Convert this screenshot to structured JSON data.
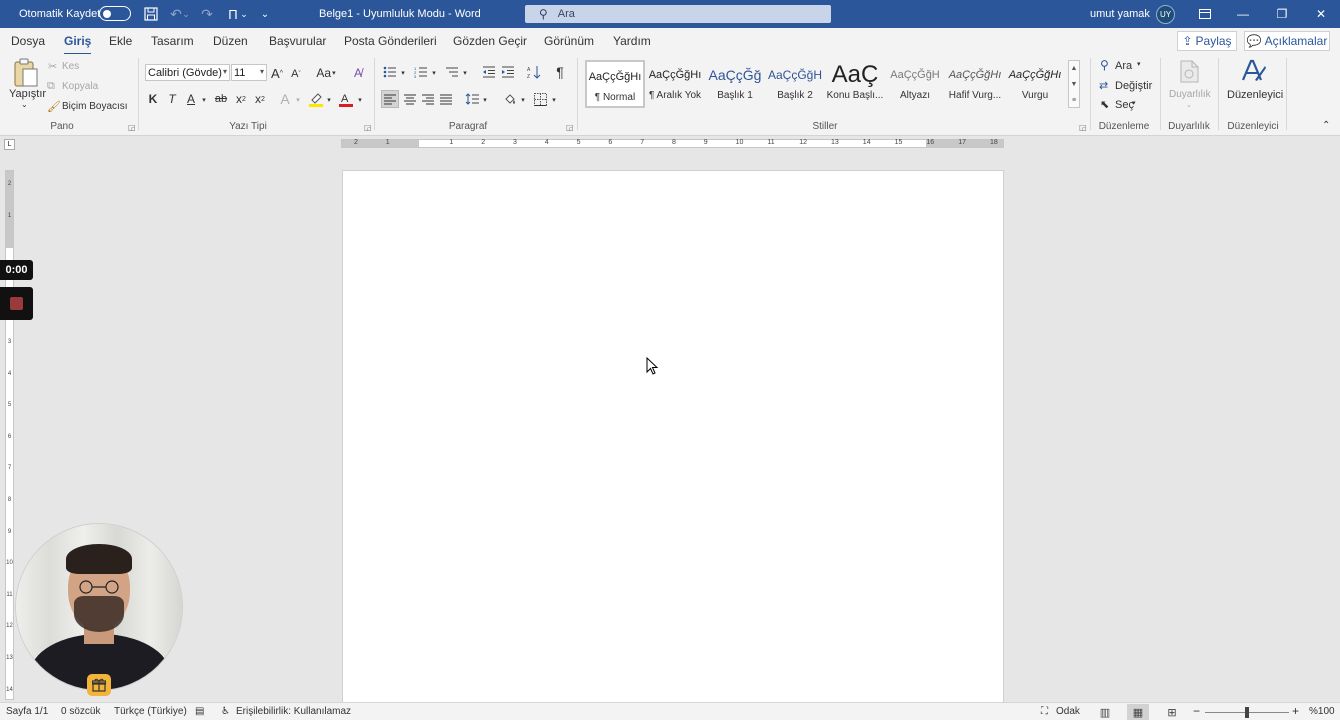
{
  "titlebar": {
    "autosave_label": "Otomatik Kaydet",
    "save_icon": "save-icon",
    "undo_icon": "undo-icon",
    "redo_icon": "redo-icon",
    "customize_icon": "customize-qat-icon",
    "doc_title": "Belge1  -  Uyumluluk Modu  -  Word",
    "search_placeholder": "Ara",
    "user_name": "umut yamak",
    "user_initials": "UY",
    "ribbon_display_icon": "ribbon-display-icon",
    "minimize_glyph": "—",
    "restore_glyph": "❐",
    "close_glyph": "✕"
  },
  "menu": {
    "tabs": [
      "Dosya",
      "Giriş",
      "Ekle",
      "Tasarım",
      "Düzen",
      "Başvurular",
      "Posta Gönderileri",
      "Gözden Geçir",
      "Görünüm",
      "Yardım"
    ],
    "active_tab": "Giriş",
    "share_label": "Paylaş",
    "comments_label": "Açıklamalar"
  },
  "ribbon": {
    "clipboard": {
      "paste": "Yapıştır",
      "cut": "Kes",
      "copy": "Kopyala",
      "format_painter": "Biçim Boyacısı",
      "label": "Pano"
    },
    "font": {
      "font_name": "Calibri (Gövde)",
      "font_size": "11",
      "grow": "A",
      "shrink": "A",
      "case": "Aa",
      "bold": "K",
      "italic": "T",
      "underline": "A",
      "strike": "ab",
      "subscript": "x",
      "superscript": "x",
      "label": "Yazı Tipi"
    },
    "paragraph": {
      "show_marks": "¶",
      "label": "Paragraf"
    },
    "styles": {
      "items": [
        {
          "preview": "AaÇçĞğHı",
          "name": "¶ Normal"
        },
        {
          "preview": "AaÇçĞğHı",
          "name": "¶ Aralık Yok"
        },
        {
          "preview": "AaÇçĞğ",
          "name": "Başlık 1"
        },
        {
          "preview": "AaÇçĞğH",
          "name": "Başlık 2"
        },
        {
          "preview": "AaÇ",
          "name": "Konu Başlı..."
        },
        {
          "preview": "AaÇçĞğH",
          "name": "Altyazı"
        },
        {
          "preview": "AaÇçĞğHı",
          "name": "Hafif Vurg..."
        },
        {
          "preview": "AaÇçĞğHı",
          "name": "Vurgu"
        }
      ],
      "selected_index": 0,
      "label": "Stiller"
    },
    "editing": {
      "find": "Ara",
      "replace": "Değiştir",
      "select": "Seç",
      "label": "Düzenleme"
    },
    "sensitivity": {
      "button": "Duyarlılık",
      "label": "Duyarlılık"
    },
    "editor": {
      "button": "Düzenleyici",
      "label": "Düzenleyici"
    }
  },
  "ruler": {
    "h_numbers": [
      "2",
      "1",
      "1",
      "2",
      "3",
      "4",
      "5",
      "6",
      "7",
      "8",
      "9",
      "10",
      "11",
      "12",
      "13",
      "14",
      "15",
      "16",
      "17",
      "18"
    ],
    "v_numbers": [
      "2",
      "1",
      "1",
      "2",
      "3",
      "4",
      "5",
      "6",
      "7",
      "8",
      "9",
      "10",
      "11",
      "12",
      "13",
      "14"
    ]
  },
  "recording": {
    "timer": "0:00"
  },
  "statusbar": {
    "page": "Sayfa 1/1",
    "words": "0 sözcük",
    "language": "Türkçe (Türkiye)",
    "accessibility": "Erişilebilirlik: Kullanılamaz",
    "focus": "Odak",
    "zoom": "%100",
    "zoom_level_percent": 100
  }
}
